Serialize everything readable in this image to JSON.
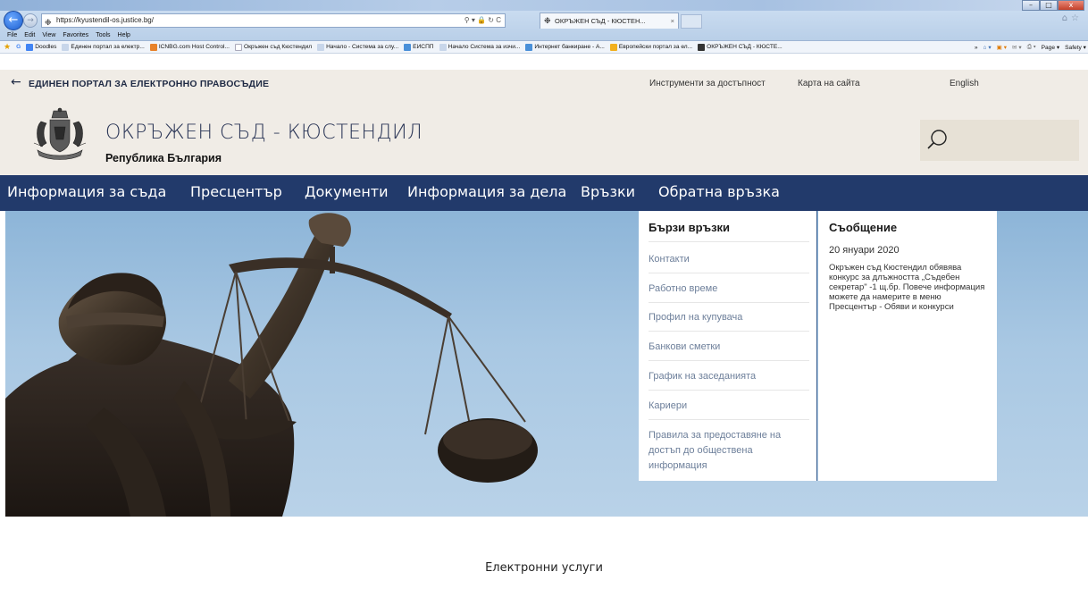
{
  "browser": {
    "address_url": "https://kyustendil-os.justice.bg/",
    "tab_title": "ОКРЪЖЕН СЪД - КЮСТЕН...",
    "window_buttons": [
      "–",
      "□",
      "x"
    ],
    "menu": [
      "File",
      "Edit",
      "View",
      "Favorites",
      "Tools",
      "Help"
    ],
    "favorites": [
      {
        "label": "Doodles",
        "color": "#4285f4"
      },
      {
        "label": "Единен портал за електр...",
        "color": "#c8d6ea"
      },
      {
        "label": "ICNBG.com Host Control...",
        "color": "#e8822a"
      },
      {
        "label": "Окръжен съд Кюстендил",
        "color": "#c8d6ea"
      },
      {
        "label": "Начало - Система за слу...",
        "color": "#c8d6ea"
      },
      {
        "label": "ЕИСПП",
        "color": "#4a90d9"
      },
      {
        "label": "Начало Система за изчи...",
        "color": "#c8d6ea"
      },
      {
        "label": "Интернет банкиране - А...",
        "color": "#4a90d9"
      },
      {
        "label": "Европейски портал за ел...",
        "color": "#f2b01e"
      },
      {
        "label": "ОКРЪЖЕН СЪД - КЮСТЕ...",
        "color": "#333333"
      }
    ],
    "command_bar": [
      "Page ▾",
      "Safety ▾"
    ]
  },
  "portal": {
    "back_link": "ЕДИНЕН ПОРТАЛ ЗА ЕЛЕКТРОННО ПРАВОСЪДИЕ",
    "accessibility": "Инструменти за достъпност",
    "sitemap": "Карта на сайта",
    "language": "English"
  },
  "header": {
    "court_name": "ОКРЪЖЕН СЪД - КЮСТЕНДИЛ",
    "country": "Република България",
    "search_icon": "search-icon"
  },
  "nav": [
    "Информация за съда",
    "Пресцентър",
    "Документи",
    "Информация за дела",
    "Връзки",
    "Обратна връзка"
  ],
  "quick_links": {
    "title": "Бързи връзки",
    "items": [
      "Контакти",
      "Работно време",
      "Профил на купувача",
      "Банкови сметки",
      "График на заседанията",
      "Кариери",
      "Правила за предоставяне на достъп до обществена информация"
    ]
  },
  "message": {
    "title": "Съобщение",
    "date": "20 януари 2020",
    "body": "Окръжен съд Кюстендил обявява конкурс за длъжността „Съдебен секретар\" -1 щ.бр. Повече информация можете да намерите в меню Пресцентър - Обяви и конкурси"
  },
  "footer": {
    "eservices": "Електронни услуги"
  },
  "colors": {
    "nav_bg": "#223a6b",
    "header_bg": "#f0ece6",
    "link": "#6d7f9a"
  }
}
